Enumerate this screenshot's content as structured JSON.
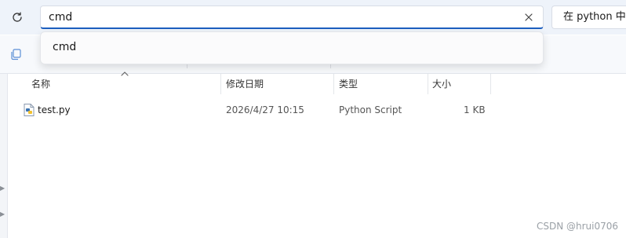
{
  "search": {
    "value": "cmd",
    "hint": "在 python 中搜",
    "suggestions": [
      "cmd"
    ]
  },
  "columns": {
    "name": "名称",
    "modified": "修改日期",
    "type": "类型",
    "size": "大小"
  },
  "files": [
    {
      "name": "test.py",
      "modified": "2026/4/27 10:15",
      "type": "Python Script",
      "size": "1 KB"
    }
  ],
  "watermark": "CSDN @hrui0706",
  "colors": {
    "accent": "#1d5fbf",
    "topbar_bg": "#eef3fa"
  },
  "icons": {
    "refresh": "refresh-icon",
    "clear": "close-icon",
    "copy": "copy-icon",
    "file": "python-file-icon",
    "sort": "sort-up-icon"
  }
}
